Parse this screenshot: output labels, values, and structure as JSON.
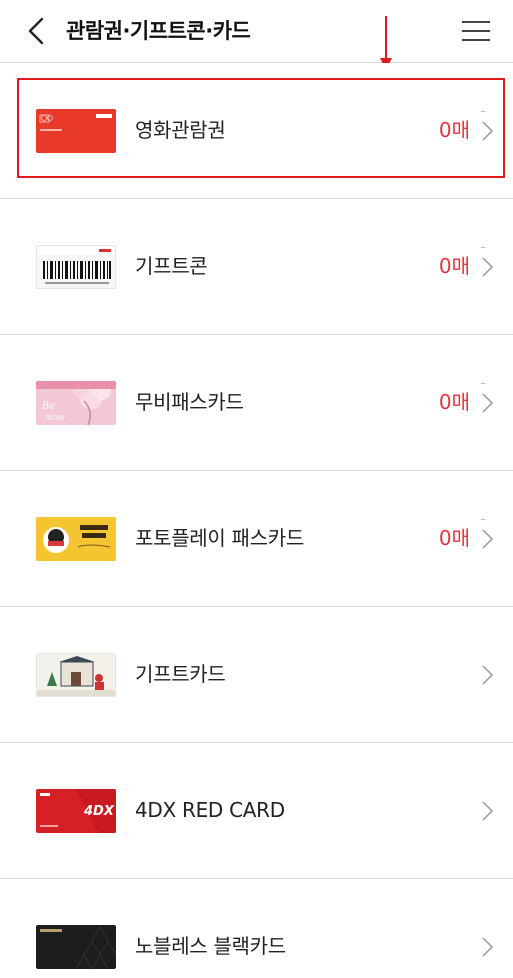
{
  "header": {
    "title": "관람권·기프트콘·카드",
    "back_icon": "chevron-left-icon",
    "menu_icon": "hamburger-menu-icon"
  },
  "items": [
    {
      "label": "영화관람권",
      "count": "0매",
      "thumb": "movie-ticket-card",
      "thumb_text": "영화관람권"
    },
    {
      "label": "기프트콘",
      "count": "0매",
      "thumb": "giftcon-barcode-card",
      "thumb_text": "8 00859 28883"
    },
    {
      "label": "무비패스카드",
      "count": "0매",
      "thumb": "moviepass-card",
      "thumb_text": "Be mine"
    },
    {
      "label": "포토플레이 패스카드",
      "count": "0매",
      "thumb": "photoplay-pass-card",
      "thumb_text": "두근두근 새출발"
    },
    {
      "label": "기프트카드",
      "count": "",
      "thumb": "gift-card"
    },
    {
      "label": "4DX RED CARD",
      "count": "",
      "thumb": "4dx-red-card",
      "thumb_text": "4DX"
    },
    {
      "label": "노블레스 블랙카드",
      "count": "",
      "thumb": "noblesse-black-card"
    }
  ],
  "colors": {
    "accent": "#e5343f",
    "annotation": "#e01b1b",
    "divider": "#d9d9d9"
  }
}
